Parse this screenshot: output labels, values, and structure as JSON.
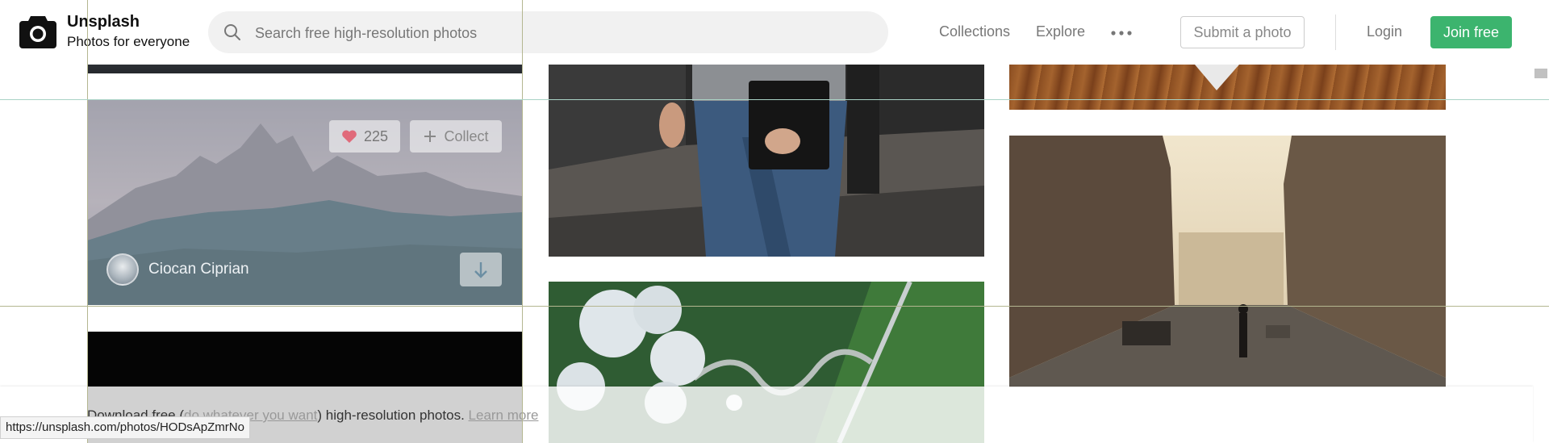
{
  "header": {
    "brand_name": "Unsplash",
    "brand_tagline": "Photos for everyone",
    "search_placeholder": "Search free high-resolution photos",
    "nav": {
      "collections": "Collections",
      "explore": "Explore",
      "more_icon": "more-horizontal-icon"
    },
    "submit_label": "Submit a photo",
    "login_label": "Login",
    "join_label": "Join free",
    "accent_color": "#3cb46e"
  },
  "photos": {
    "hover_card": {
      "likes": "225",
      "collect_label": "Collect",
      "author": "Ciocan Ciprian"
    }
  },
  "footer": {
    "text_before": "Download free (",
    "link_whatever": "do whatever you want",
    "text_after": ") high-resolution photos.",
    "learn_more": "Learn more"
  },
  "status_bar": {
    "url": "https://unsplash.com/photos/HODsApZmrNo"
  }
}
